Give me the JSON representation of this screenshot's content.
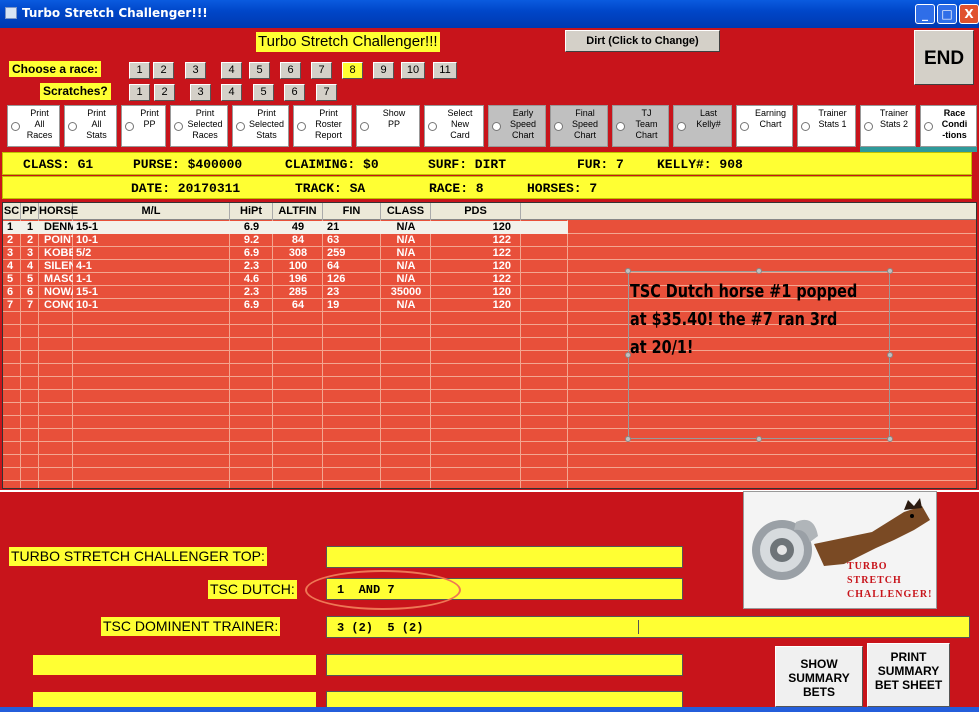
{
  "window": {
    "title": "Turbo Stretch Challenger!!!",
    "min": "_",
    "max": "□",
    "close": "X"
  },
  "header": {
    "title": "Turbo Stretch Challenger!!!",
    "surface_button": "Dirt (Click to Change)",
    "end_button": "END"
  },
  "race_select": {
    "label": "Choose  a race:",
    "races": [
      "1",
      "2",
      "3",
      "4",
      "5",
      "6",
      "7",
      "8",
      "9",
      "10",
      "11"
    ],
    "selected": "8"
  },
  "scratches": {
    "label": "Scratches?",
    "items": [
      "1",
      "2",
      "3",
      "4",
      "5",
      "6",
      "7"
    ]
  },
  "options": [
    "Print\nAll\nRaces",
    "Print\nAll\nStats",
    "Print\nPP",
    "Print\nSelected\nRaces",
    "Print\nSelected\nStats",
    "Print\nRoster\nReport",
    "Show\nPP",
    "Select\nNew\nCard",
    "Early\nSpeed\nChart",
    "Final\nSpeed\nChart",
    "TJ\nTeam\nChart",
    "Last\nKelly#",
    "Earning\nChart",
    "Trainer\nStats 1",
    "Trainer\nStats 2",
    "Race\nCondi\n-tions"
  ],
  "race_info": {
    "class": "CLASS: G1",
    "purse": "PURSE: $400000",
    "claiming": "CLAIMING: $0",
    "surf": "SURF: DIRT",
    "fur": "FUR: 7",
    "kelly": "KELLY#: 908",
    "date": "DATE: 20170311",
    "track": "TRACK: SA",
    "race": "RACE: 8",
    "horses": "HORSES: 7"
  },
  "table": {
    "columns": [
      "SC",
      "PP",
      "HORSE NAME",
      "M/L",
      "HiPt",
      "ALTFIN",
      "FIN",
      "CLASS",
      "PDS"
    ],
    "rows": [
      [
        "1",
        "1",
        "DENMAN'S CALL",
        "15-1",
        "6.9",
        "49",
        "21",
        "N/A",
        "120"
      ],
      [
        "2",
        "2",
        "POINT PIPER",
        "10-1",
        "9.2",
        "84",
        "63",
        "N/A",
        "122"
      ],
      [
        "3",
        "3",
        "KOBE'S BACK",
        "5/2",
        "6.9",
        "308",
        "259",
        "N/A",
        "122"
      ],
      [
        "4",
        "4",
        "SILENT BIRD",
        "4-1",
        "2.3",
        "100",
        "64",
        "N/A",
        "120"
      ],
      [
        "5",
        "5",
        "MASOCHISTIC",
        "1-1",
        "4.6",
        "196",
        "126",
        "N/A",
        "122"
      ],
      [
        "6",
        "6",
        "NOWALKING",
        "15-1",
        "2.3",
        "285",
        "23",
        "35000",
        "120"
      ],
      [
        "7",
        "7",
        "CONQUEST COBRA",
        "10-1",
        "6.9",
        "64",
        "19",
        "N/A",
        "120"
      ]
    ]
  },
  "note": {
    "lines": [
      "TSC Dutch horse #1 popped",
      "at $35.40!   the #7 ran 3rd",
      "at 20/1!"
    ]
  },
  "bottom": {
    "top_label": "TURBO STRETCH CHALLENGER TOP:",
    "top_value": "",
    "dutch_label": "TSC DUTCH:",
    "dutch_value": "1  AND 7",
    "trainer_label": "TSC DOMINENT TRAINER:",
    "trainer_value": "3 (2)  5 (2)",
    "show_summary": "SHOW SUMMARY BETS",
    "print_summary": "PRINT SUMMARY BET SHEET",
    "logo_text": "TURBO STRETCH CHALLENGER!",
    "highlight_color": "#e8503a"
  }
}
